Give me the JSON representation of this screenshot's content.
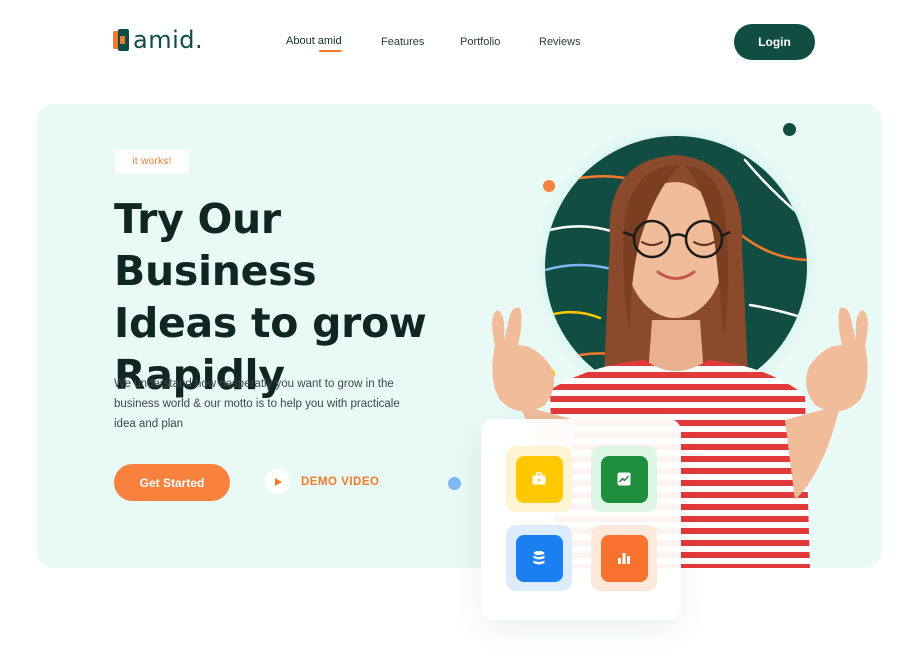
{
  "brand": {
    "name": "amid."
  },
  "nav": {
    "items": [
      {
        "label": "About amid",
        "active": true
      },
      {
        "label": "Features",
        "active": false
      },
      {
        "label": "Portfolio",
        "active": false
      },
      {
        "label": "Reviews",
        "active": false
      }
    ],
    "login_label": "Login"
  },
  "hero": {
    "badge": "it works!",
    "headline_lines": [
      "Try Our Business",
      "Ideas to grow",
      "Rapidly"
    ],
    "description": "We understand how desperatly you want to grow in the business world & our motto is to help you with practicale idea and plan",
    "cta_label": "Get Started",
    "demo_label": "DEMO VIDEO"
  },
  "feature_card": {
    "tiles": [
      {
        "icon": "briefcase-icon",
        "color": "#ffc800",
        "bg": "#fff4d1"
      },
      {
        "icon": "trend-chart-icon",
        "color": "#1f8e3d",
        "bg": "#dff5e4"
      },
      {
        "icon": "database-icon",
        "color": "#1a7ff0",
        "bg": "#dcecfc"
      },
      {
        "icon": "bar-chart-icon",
        "color": "#f7722e",
        "bg": "#fde8dc"
      }
    ]
  },
  "colors": {
    "primary": "#114d43",
    "accent": "#f47a2b",
    "hero_bg": "#e9f9f6",
    "heading": "#0f2622"
  }
}
